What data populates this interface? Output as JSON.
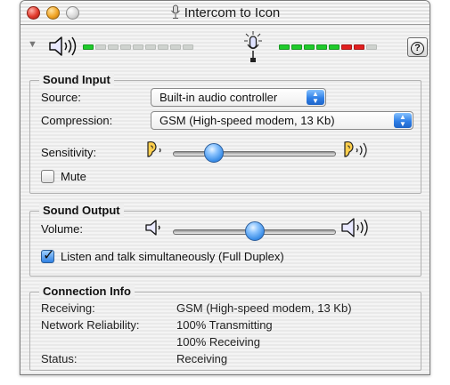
{
  "window": {
    "title": "Intercom to Icon"
  },
  "toolbar": {
    "help_glyph": "?",
    "output_meter": [
      "on-g",
      "off",
      "off",
      "off",
      "off",
      "off",
      "off",
      "off",
      "off"
    ],
    "input_meter": [
      "on-g",
      "on-g",
      "on-g",
      "on-g",
      "on-g",
      "on-r",
      "on-r",
      "off"
    ],
    "colors": {
      "meter_green": "#1fcb2b",
      "meter_red": "#e21f1f",
      "accent_blue": "#2f7fe6"
    }
  },
  "sound_input": {
    "heading": "Sound Input",
    "source_label": "Source:",
    "source_value": "Built-in audio controller",
    "compression_label": "Compression:",
    "compression_value": "GSM (High-speed modem, 13 Kb)",
    "sensitivity_label": "Sensitivity:",
    "sensitivity_level": 0.22,
    "mute_label": "Mute",
    "mute_checked": false
  },
  "sound_output": {
    "heading": "Sound Output",
    "volume_label": "Volume:",
    "volume_level": 0.5,
    "duplex_label": "Listen and talk simultaneously (Full Duplex)",
    "duplex_checked": true
  },
  "connection_info": {
    "heading": "Connection Info",
    "receiving_label": "Receiving:",
    "receiving_value": "GSM (High-speed modem, 13 Kb)",
    "reliability_label": "Network Reliability:",
    "reliability_value_1": "100% Transmitting",
    "reliability_value_2": "100% Receiving",
    "status_label": "Status:",
    "status_value": "Receiving"
  }
}
